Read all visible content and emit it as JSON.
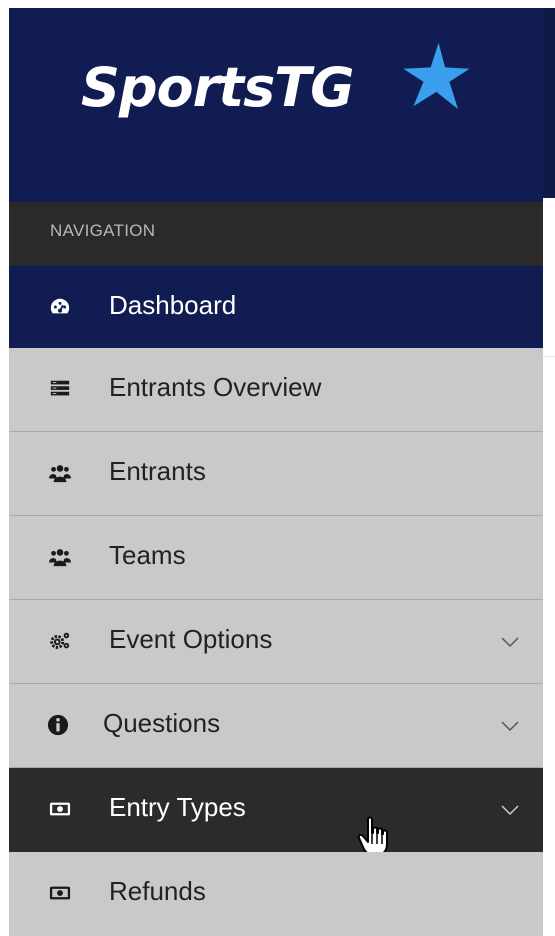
{
  "brand": {
    "logo_text": "SportsTG",
    "navy": "#111d52",
    "star_color": "#3aa0ee"
  },
  "navigation": {
    "header": "NAVIGATION",
    "items": [
      {
        "label": "Dashboard",
        "icon": "dashboard-icon",
        "state": "active",
        "has_submenu": false
      },
      {
        "label": "Entrants Overview",
        "icon": "list-icon",
        "state": "normal",
        "has_submenu": false
      },
      {
        "label": "Entrants",
        "icon": "users-icon",
        "state": "normal",
        "has_submenu": false
      },
      {
        "label": "Teams",
        "icon": "users-icon",
        "state": "normal",
        "has_submenu": false
      },
      {
        "label": "Event Options",
        "icon": "cogs-icon",
        "state": "normal",
        "has_submenu": true
      },
      {
        "label": "Questions",
        "icon": "info-icon",
        "state": "normal",
        "has_submenu": true
      },
      {
        "label": "Entry Types",
        "icon": "money-icon",
        "state": "hover",
        "has_submenu": true
      },
      {
        "label": "Refunds",
        "icon": "money-icon",
        "state": "normal",
        "has_submenu": false
      }
    ]
  },
  "colors": {
    "sidebar_bg": "#c9c9c9",
    "header_bg": "#2a2a2a",
    "hover_bg": "#2b2b2b"
  },
  "cursor": "hand-pointer-cursor-icon"
}
